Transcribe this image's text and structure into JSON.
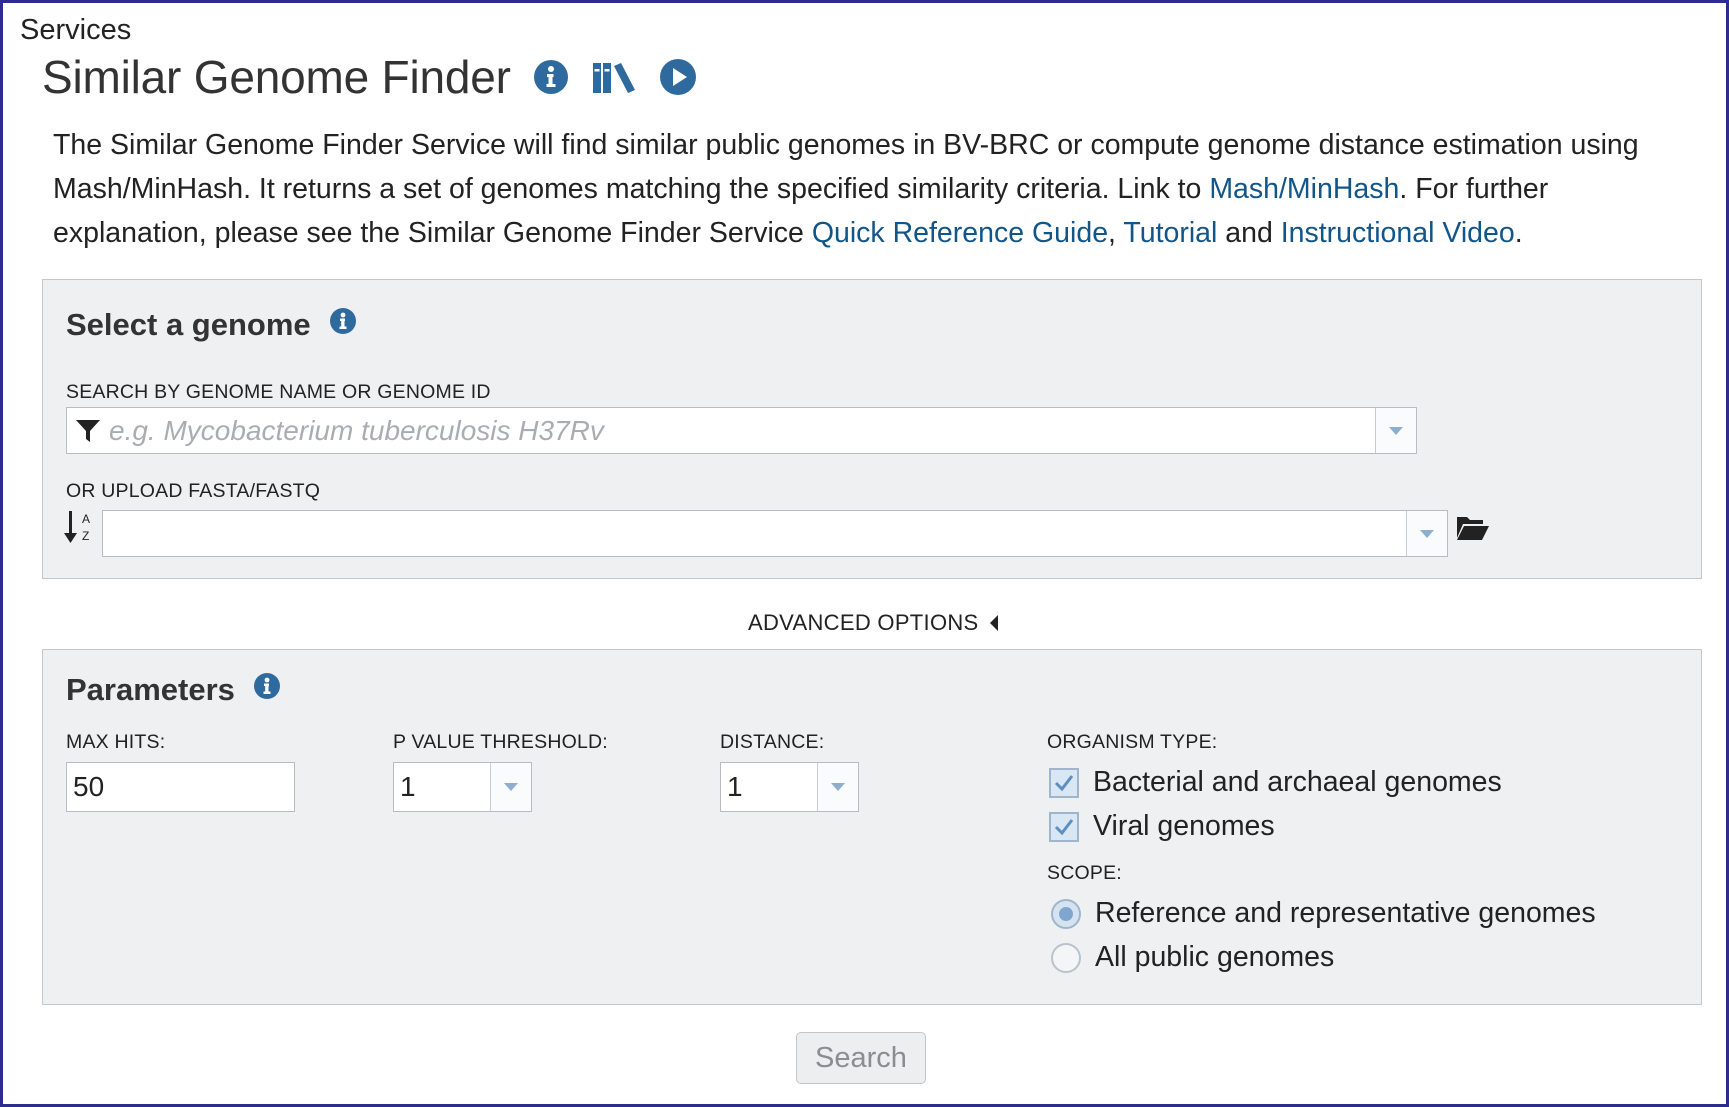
{
  "breadcrumb": "Services",
  "page": {
    "title": "Similar Genome Finder",
    "icons": [
      "info-icon",
      "books-icon",
      "play-icon"
    ]
  },
  "description": {
    "part1": "The Similar Genome Finder Service will find similar public genomes in BV-BRC or compute genome distance estimation using Mash/MinHash. It returns a set of genomes matching the specified similarity criteria. Link to ",
    "link_mash": "Mash/MinHash",
    "part2": ". For further explanation, please see the Similar Genome Finder Service ",
    "link_guide": "Quick Reference Guide",
    "sep1": ", ",
    "link_tutorial": "Tutorial",
    "sep2": " and ",
    "link_video": "Instructional Video",
    "end": "."
  },
  "select_genome": {
    "title": "Select a genome",
    "search_label": "SEARCH BY GENOME NAME OR GENOME ID",
    "search_placeholder": "e.g. Mycobacterium tuberculosis H37Rv",
    "search_value": "",
    "upload_label": "OR UPLOAD FASTA/FASTQ",
    "upload_value": ""
  },
  "advanced_options": {
    "label": "ADVANCED OPTIONS",
    "expanded": false
  },
  "parameters": {
    "title": "Parameters",
    "max_hits": {
      "label": "MAX HITS:",
      "value": "50"
    },
    "p_value": {
      "label": "P VALUE THRESHOLD:",
      "value": "1"
    },
    "distance": {
      "label": "DISTANCE:",
      "value": "1"
    },
    "organism_type": {
      "label": "ORGANISM TYPE:",
      "options": [
        {
          "label": "Bacterial and archaeal genomes",
          "checked": true
        },
        {
          "label": "Viral genomes",
          "checked": true
        }
      ]
    },
    "scope": {
      "label": "SCOPE:",
      "options": [
        {
          "label": "Reference and representative genomes",
          "selected": true
        },
        {
          "label": "All public genomes",
          "selected": false
        }
      ]
    }
  },
  "search_button": "Search",
  "colors": {
    "link": "#115589",
    "icon": "#2f6a9f",
    "frame": "#2e2d8e",
    "panel_bg": "#eff0f2"
  }
}
